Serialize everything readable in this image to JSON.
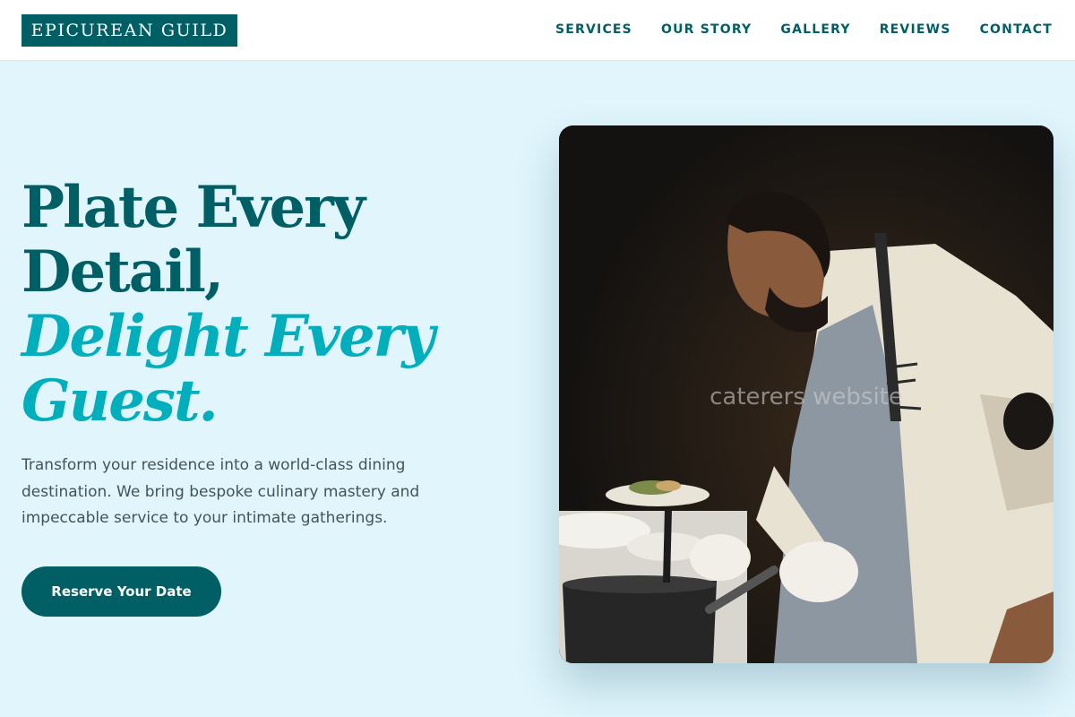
{
  "brand": {
    "logo_text": "EPICUREAN GUILD"
  },
  "nav": {
    "items": [
      {
        "label": "SERVICES"
      },
      {
        "label": "OUR STORY"
      },
      {
        "label": "GALLERY"
      },
      {
        "label": "REVIEWS"
      },
      {
        "label": "CONTACT"
      }
    ]
  },
  "hero": {
    "title_line1": "Plate Every",
    "title_line2": "Detail,",
    "title_accent_line1": "Delight Every",
    "title_accent_line2": "Guest.",
    "subtitle": "Transform your residence into a world-class dining destination. We bring bespoke culinary mastery and impeccable service to your intimate gatherings.",
    "cta_label": "Reserve Your Date",
    "image_alt": "Chef plating dishes in a dark kitchen",
    "image_overlay_text": "caterers website"
  },
  "colors": {
    "brand_dark": "#005f65",
    "brand_accent": "#00aebc",
    "page_background": "#e0f5fc",
    "body_text": "#44535a"
  }
}
